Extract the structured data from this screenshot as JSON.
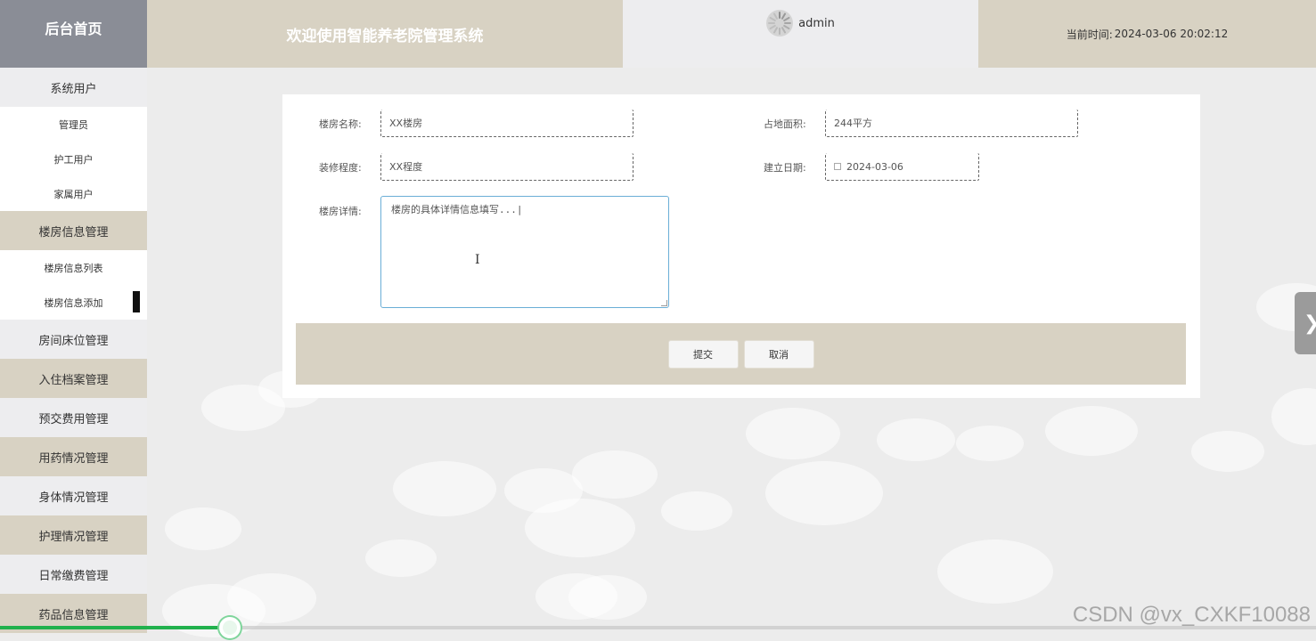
{
  "header": {
    "brand": "后台首页",
    "welcome": "欢迎使用智能养老院管理系统",
    "username": "admin",
    "time_label": "当前时间:",
    "time_value": "2024-03-06 20:02:12"
  },
  "sidebar": {
    "group_users": "系统用户",
    "sub_users": [
      "管理员",
      "护工用户",
      "家属用户"
    ],
    "group_building": "楼房信息管理",
    "sub_building": [
      "楼房信息列表",
      "楼房信息添加"
    ],
    "groups_rest": [
      "房间床位管理",
      "入住档案管理",
      "预交费用管理",
      "用药情况管理",
      "身体情况管理",
      "护理情况管理",
      "日常缴费管理",
      "药品信息管理"
    ]
  },
  "form": {
    "name_label": "楼房名称:",
    "name_value": "XX楼房",
    "area_label": "占地面积:",
    "area_value": "244平方",
    "decor_label": "装修程度:",
    "decor_value": "XX程度",
    "date_label": "建立日期:",
    "date_value": "2024-03-06",
    "detail_label": "楼房详情:",
    "detail_value": "楼房的具体详情信息填写...|",
    "submit": "提交",
    "cancel": "取消"
  },
  "player": {
    "progress": 0.175
  },
  "watermark": "CSDN @vx_CXKF10088",
  "colors": {
    "tan": "#d8d2c3",
    "brand_bg": "#8a8d96",
    "progress": "#21b14d",
    "textarea_focus": "#6aaed6"
  }
}
